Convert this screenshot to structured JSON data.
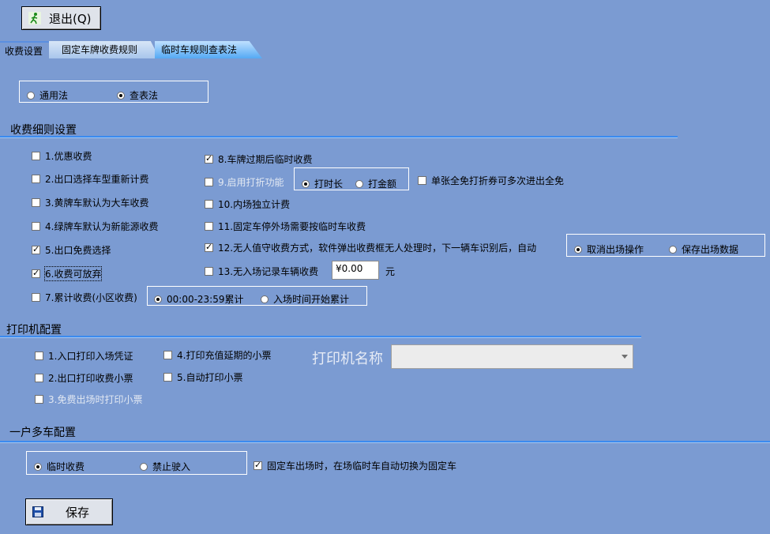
{
  "toolbar": {
    "exit_label": "退出(Q)",
    "save_label": "保存"
  },
  "tabs": [
    "收费设置",
    "固定车牌收费规则",
    "临时车规则查表法"
  ],
  "method": {
    "options": [
      "通用法",
      "查表法"
    ],
    "selected": "查表法"
  },
  "sections": {
    "fee": "收费细则设置",
    "printer": "打印机配置",
    "multi": "一户多车配置"
  },
  "fee_items_left": [
    {
      "label": "1.优惠收费",
      "checked": false
    },
    {
      "label": "2.出口选择车型重新计费",
      "checked": false
    },
    {
      "label": "3.黄牌车默认为大车收费",
      "checked": false
    },
    {
      "label": "4.绿牌车默认为新能源收费",
      "checked": false
    },
    {
      "label": "5.出口免费选择",
      "checked": true
    },
    {
      "label": "6.收费可放弃",
      "checked": true
    },
    {
      "label": "7.累计收费(小区收费)",
      "checked": false
    }
  ],
  "fee_items_right": [
    {
      "label": "8.车牌过期后临时收费",
      "checked": true
    },
    {
      "label": "9.启用打折功能",
      "checked": false,
      "disabled": true
    },
    {
      "label": "10.内场独立计费",
      "checked": false
    },
    {
      "label": "11.固定车停外场需要按临时车收费",
      "checked": false
    },
    {
      "label": "12.无人值守收费方式，软件弹出收费框无人处理时，下一辆车识别后，自动",
      "checked": true
    },
    {
      "label": "13.无入场记录车辆收费",
      "checked": false
    }
  ],
  "discount_options": [
    "打时长",
    "打金额"
  ],
  "discount_selected": "打时长",
  "single_full_free": {
    "label": "单张全免打折券可多次进出全免",
    "checked": false
  },
  "unattended_options": [
    "取消出场操作",
    "保存出场数据"
  ],
  "unattended_selected": "取消出场操作",
  "no_entry_fee": {
    "value": "¥0.00",
    "unit": "元"
  },
  "cumulative_options": [
    "00:00-23:59累计",
    "入场时间开始累计"
  ],
  "cumulative_selected": "00:00-23:59累计",
  "printer": {
    "items": [
      {
        "label": "1.入口打印入场凭证",
        "checked": false
      },
      {
        "label": "2.出口打印收费小票",
        "checked": false
      },
      {
        "label": "3.免费出场时打印小票",
        "checked": false,
        "disabled": true
      },
      {
        "label": "4.打印充值延期的小票",
        "checked": false
      },
      {
        "label": "5.自动打印小票",
        "checked": false
      }
    ],
    "name_label": "打印机名称",
    "name_value": ""
  },
  "multi_car": {
    "options": [
      "临时收费",
      "禁止驶入"
    ],
    "selected": "临时收费",
    "auto_switch": {
      "label": "固定车出场时，在场临时车自动切换为固定车",
      "checked": true
    }
  },
  "colors": {
    "background": "#7b9bd2",
    "divider": "#3b8bf0"
  },
  "icons": {
    "exit": "exit-run-icon",
    "save": "floppy-disk-icon"
  }
}
